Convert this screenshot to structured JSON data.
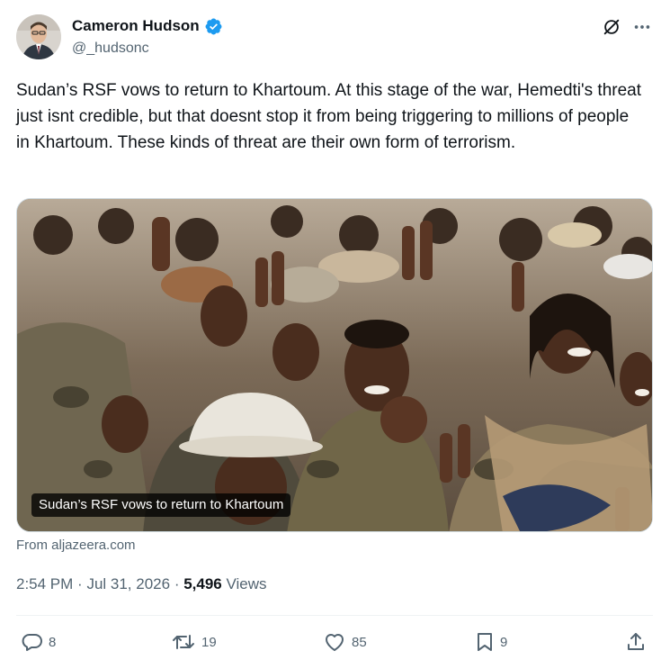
{
  "author": {
    "display_name": "Cameron Hudson",
    "handle": "@_hudsonc",
    "verified": true
  },
  "tweet": {
    "text": "Sudan’s RSF vows to return to Khartoum. At this stage of the war, Hemedti's threat just isnt credible, but that doesnt stop it from being triggering to millions of people in Khartoum. These kinds of threat are their own form of terrorism."
  },
  "media": {
    "caption": "Sudan’s RSF vows to return to Khartoum",
    "source": "From aljazeera.com"
  },
  "meta": {
    "time": "2:54 PM",
    "date": "Jul 31, 2026",
    "views_count": "5,496",
    "views_label": "Views"
  },
  "actions": {
    "replies": "8",
    "reposts": "19",
    "likes": "85",
    "bookmarks": "9"
  },
  "colors": {
    "verified": "#1d9bf0",
    "secondary_text": "#536471",
    "primary_text": "#0f1419"
  },
  "icons": [
    "grok-icon",
    "more-icon",
    "verified-badge-icon",
    "reply-icon",
    "repost-icon",
    "like-icon",
    "bookmark-icon",
    "share-icon"
  ]
}
